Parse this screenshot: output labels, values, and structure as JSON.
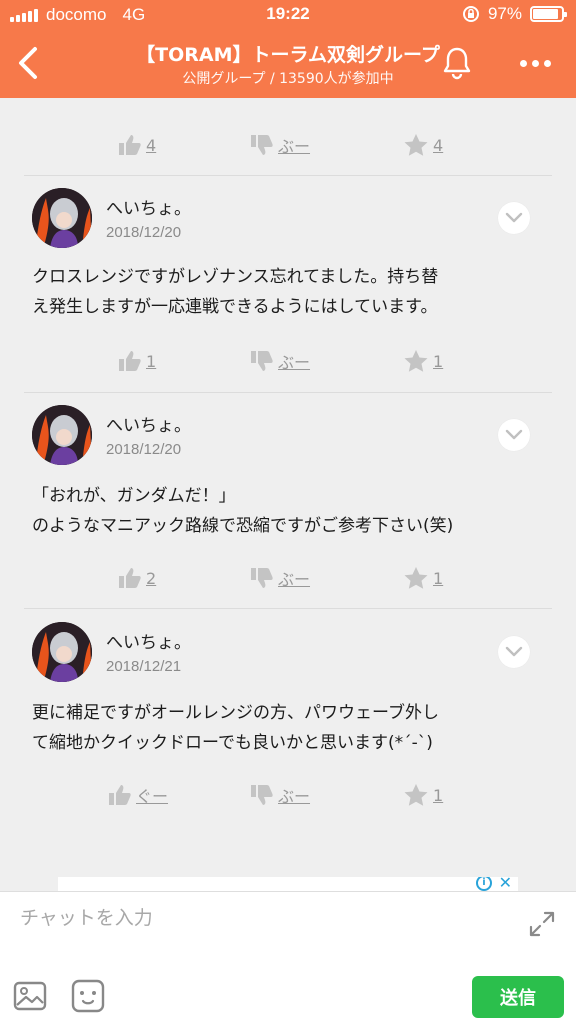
{
  "status_bar": {
    "carrier": "docomo",
    "network": "4G",
    "time": "19:22",
    "battery": "97%",
    "battery_level": 0.97
  },
  "header": {
    "title": "【TORAM】トーラム双剣グループ",
    "subtitle": "公開グループ / 13590人が参加中",
    "accent_color": "#f7794a"
  },
  "top_reactions": {
    "like": "4",
    "dislike": "ぶー",
    "star": "4"
  },
  "posts": [
    {
      "author": "へいちょ。",
      "date": "2018/12/20",
      "lines": [
        "クロスレンジですがレゾナンス忘れてました。持ち替",
        "え発生しますが一応連戦できるようにはしています。"
      ],
      "reactions": {
        "like": "1",
        "dislike": "ぶー",
        "star": "1"
      }
    },
    {
      "author": "へいちょ。",
      "date": "2018/12/20",
      "lines": [
        "「おれが、ガンダムだ！」",
        "のようなマニアック路線で恐縮ですがご参考下さい(笑)"
      ],
      "reactions": {
        "like": "2",
        "dislike": "ぶー",
        "star": "1"
      }
    },
    {
      "author": "へいちょ。",
      "date": "2018/12/21",
      "lines": [
        "更に補足ですがオールレンジの方、パワウェーブ外し",
        "て縮地かクイックドローでも良いかと思います(*´-`)"
      ],
      "reactions": {
        "like": "ぐー",
        "dislike": "ぶー",
        "star": "1"
      }
    }
  ],
  "chat": {
    "placeholder": "チャットを入力",
    "send_label": "送信",
    "send_color": "#2bbf4c"
  }
}
